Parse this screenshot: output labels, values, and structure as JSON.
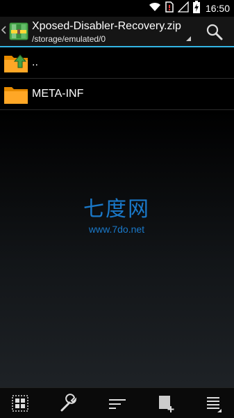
{
  "status_bar": {
    "time": "16:50",
    "icons": [
      "wifi-icon",
      "sim-alert-icon",
      "signal-icon",
      "battery-charging-icon"
    ]
  },
  "action_bar": {
    "title": "Xposed-Disabler-Recovery.zip",
    "path": "/storage/emulated/0",
    "accent_color": "#33b5e5",
    "icons": [
      "up-chevron-icon",
      "archive-app-icon",
      "spinner-arrow-icon",
      "search-icon"
    ]
  },
  "files": [
    {
      "name": "..",
      "icon": "folder-up-icon"
    },
    {
      "name": "META-INF",
      "icon": "folder-icon"
    }
  ],
  "watermark": {
    "text_cn": "七度网",
    "url": "www.7do.net"
  },
  "bottom_bar": {
    "icons": [
      "select-grid-icon",
      "wrench-icon",
      "sort-icon",
      "new-file-icon",
      "menu-list-icon"
    ]
  }
}
